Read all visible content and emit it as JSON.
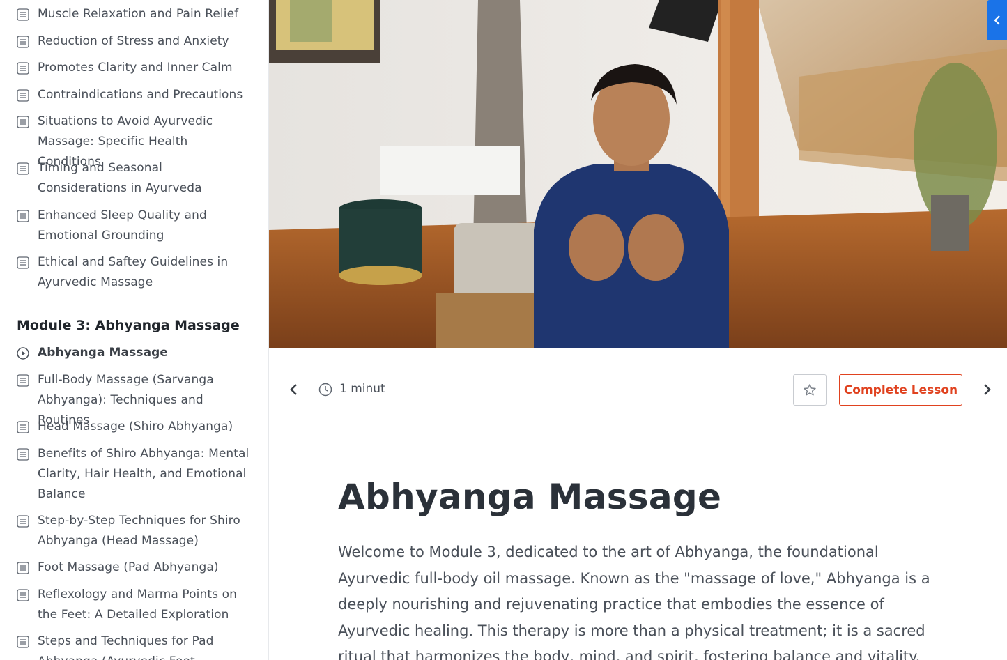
{
  "sidebar": {
    "lessons_above": [
      {
        "label": "Muscle Relaxation and Pain Relief",
        "icon": "document-icon"
      },
      {
        "label": "Reduction of Stress and Anxiety",
        "icon": "document-icon"
      },
      {
        "label": "Promotes Clarity and Inner Calm",
        "icon": "document-icon"
      },
      {
        "label": "Contraindications and Precautions",
        "icon": "document-icon"
      },
      {
        "label": "Situations to Avoid Ayurvedic Massage: Specific Health Conditions",
        "icon": "document-icon"
      },
      {
        "label": "Timing and Seasonal Considerations in Ayurveda",
        "icon": "document-icon"
      },
      {
        "label": "Enhanced Sleep Quality and Emotional Grounding",
        "icon": "document-icon"
      },
      {
        "label": "Ethical and Saftey Guidelines in Ayurvedic Massage",
        "icon": "document-icon"
      }
    ],
    "module_title": "Module 3: Abhyanga Massage",
    "module_lessons": [
      {
        "label": "Abhyanga Massage",
        "icon": "play-circle-icon",
        "active": true
      },
      {
        "label": "Full-Body Massage (Sarvanga Abhyanga): Techniques and Routines",
        "icon": "document-icon"
      },
      {
        "label": "Head Massage (Shiro Abhyanga)",
        "icon": "document-icon"
      },
      {
        "label": "Benefits of Shiro Abhyanga: Mental Clarity, Hair Health, and Emotional Balance",
        "icon": "document-icon"
      },
      {
        "label": "Step-by-Step Techniques for Shiro Abhyanga (Head Massage)",
        "icon": "document-icon"
      },
      {
        "label": "Foot Massage (Pad Abhyanga)",
        "icon": "document-icon"
      },
      {
        "label": "Reflexology and Marma Points on the Feet: A Detailed Exploration",
        "icon": "document-icon"
      },
      {
        "label": "Steps and Techniques for Pad Abhyanga (Ayurvedic Foot Massage)",
        "icon": "document-icon"
      }
    ]
  },
  "toolbar": {
    "duration": "1 minut",
    "complete_label": "Complete Lesson"
  },
  "lesson": {
    "title": "Abhyanga Massage",
    "body": "Welcome to Module 3, dedicated to the art of Abhyanga, the foundational Ayurvedic full-body oil massage. Known as the \"massage of love,\" Abhyanga is a deeply nourishing and rejuvenating practice that embodies the essence of Ayurvedic healing. This therapy is more than a physical treatment; it is a sacred ritual that harmonizes the body, mind, and spirit, fostering balance and vitality."
  },
  "colors": {
    "accent": "#e0421f",
    "collapse_tab": "#1a73e8",
    "text": "#4a5059",
    "heading": "#2b3139"
  }
}
